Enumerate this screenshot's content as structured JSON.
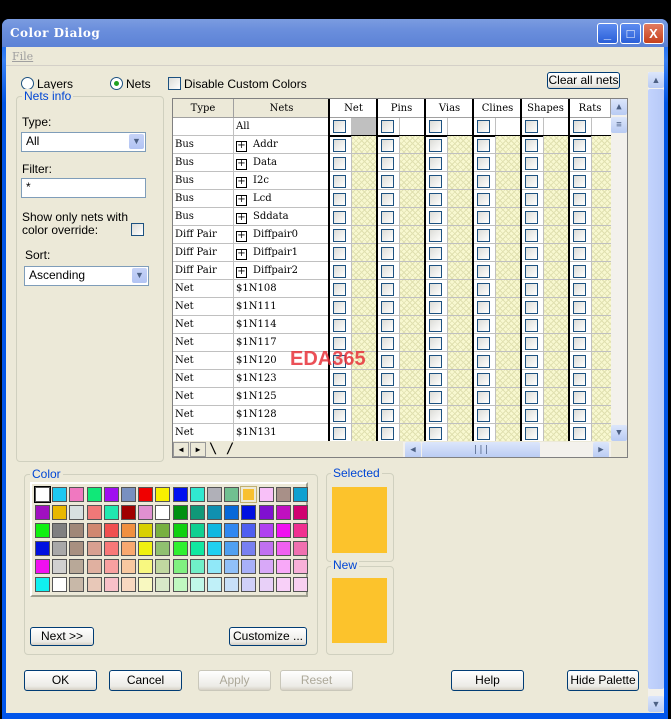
{
  "window": {
    "title": "Color Dialog",
    "minimize": "_",
    "maximize": "□",
    "close": "X"
  },
  "menu": {
    "file": "File"
  },
  "mode": {
    "layers": "Layers",
    "nets": "Nets",
    "selected": "nets",
    "disable_custom": "Disable Custom Colors",
    "disable_custom_checked": false
  },
  "clear_all": "Clear all nets",
  "nets_info": {
    "title": "Nets info",
    "type_label": "Type:",
    "type_value": "All",
    "filter_label": "Filter:",
    "filter_value": "*",
    "show_only_label1": "Show only nets with",
    "show_only_label2": "color override:",
    "show_only_checked": false,
    "sort_label": "Sort:",
    "sort_value": "Ascending"
  },
  "grid": {
    "columns": [
      "Type",
      "Nets",
      "Net",
      "Pins",
      "Vias",
      "Clines",
      "Shapes",
      "Rats"
    ],
    "rows": [
      {
        "type": "",
        "net": "All",
        "expand": false
      },
      {
        "type": "Bus",
        "net": "Addr",
        "expand": true
      },
      {
        "type": "Bus",
        "net": "Data",
        "expand": true
      },
      {
        "type": "Bus",
        "net": "I2c",
        "expand": true
      },
      {
        "type": "Bus",
        "net": "Lcd",
        "expand": true
      },
      {
        "type": "Bus",
        "net": "Sddata",
        "expand": true
      },
      {
        "type": "Diff Pair",
        "net": "Diffpair0",
        "expand": true
      },
      {
        "type": "Diff Pair",
        "net": "Diffpair1",
        "expand": true
      },
      {
        "type": "Diff Pair",
        "net": "Diffpair2",
        "expand": true
      },
      {
        "type": "Net",
        "net": "$1N108",
        "expand": false
      },
      {
        "type": "Net",
        "net": "$1N111",
        "expand": false
      },
      {
        "type": "Net",
        "net": "$1N114",
        "expand": false
      },
      {
        "type": "Net",
        "net": "$1N117",
        "expand": false
      },
      {
        "type": "Net",
        "net": "$1N120",
        "expand": false
      },
      {
        "type": "Net",
        "net": "$1N123",
        "expand": false
      },
      {
        "type": "Net",
        "net": "$1N125",
        "expand": false
      },
      {
        "type": "Net",
        "net": "$1N128",
        "expand": false
      },
      {
        "type": "Net",
        "net": "$1N131",
        "expand": false
      }
    ]
  },
  "watermark": "EDA365",
  "color": {
    "title": "Color",
    "selected_index": 12,
    "palette": [
      "#ffffff",
      "#1ec8f0",
      "#f078c0",
      "#10e878",
      "#a010f0",
      "#7890c0",
      "#f00000",
      "#f8f000",
      "#0010f0",
      "#30e8d0",
      "#b0b0b8",
      "#70c090",
      "#f8c030",
      "#f8c0f8",
      "#a89088",
      "#10a0d0",
      "#a010c0",
      "#e8b800",
      "#d8e0e0",
      "#f07878",
      "#20e8b0",
      "#a00000",
      "#e090d0",
      "#ffffff",
      "#009010",
      "#109878",
      "#1090b0",
      "#0868d8",
      "#0010e0",
      "#8010d0",
      "#c010c0",
      "#d00070",
      "#10f010",
      "#808080",
      "#a08878",
      "#d08870",
      "#f05050",
      "#f09040",
      "#d8d000",
      "#78b040",
      "#10d010",
      "#10d090",
      "#10b8e0",
      "#3088f0",
      "#5060f0",
      "#b040f0",
      "#f010f0",
      "#f03090",
      "#0010e0",
      "#a8a8a8",
      "#a89080",
      "#d8a090",
      "#f87878",
      "#f8a870",
      "#f0f010",
      "#90c070",
      "#30f030",
      "#10e8a0",
      "#20d0f0",
      "#50a0f0",
      "#7880f0",
      "#c070f0",
      "#f060f0",
      "#f070b0",
      "#f010f0",
      "#d0d0d0",
      "#b8a898",
      "#e0b0a0",
      "#f8a0a0",
      "#f8c8a0",
      "#f8f880",
      "#c0d8a0",
      "#80f080",
      "#70f0c8",
      "#90e8f8",
      "#90c0f8",
      "#a8b0f8",
      "#d8a8f8",
      "#f8a8f8",
      "#f8b0d8",
      "#10f0f0",
      "#ffffff",
      "#c8b8a8",
      "#e8c8b8",
      "#f8c0c8",
      "#f8d8c0",
      "#f8f8c0",
      "#d8e8c8",
      "#c0f8c0",
      "#c0f8e8",
      "#c0f0f8",
      "#c8e0f8",
      "#d0d0f8",
      "#e8d0f8",
      "#f8d0f8",
      "#f8d0f0"
    ],
    "next": "Next >>",
    "customize": "Customize ..."
  },
  "selected": {
    "title": "Selected",
    "color": "#fcc32c"
  },
  "new": {
    "title": "New",
    "color": "#fcc32c"
  },
  "buttons": {
    "ok": "OK",
    "cancel": "Cancel",
    "apply": "Apply",
    "reset": "Reset",
    "help": "Help",
    "hide_palette": "Hide Palette"
  }
}
